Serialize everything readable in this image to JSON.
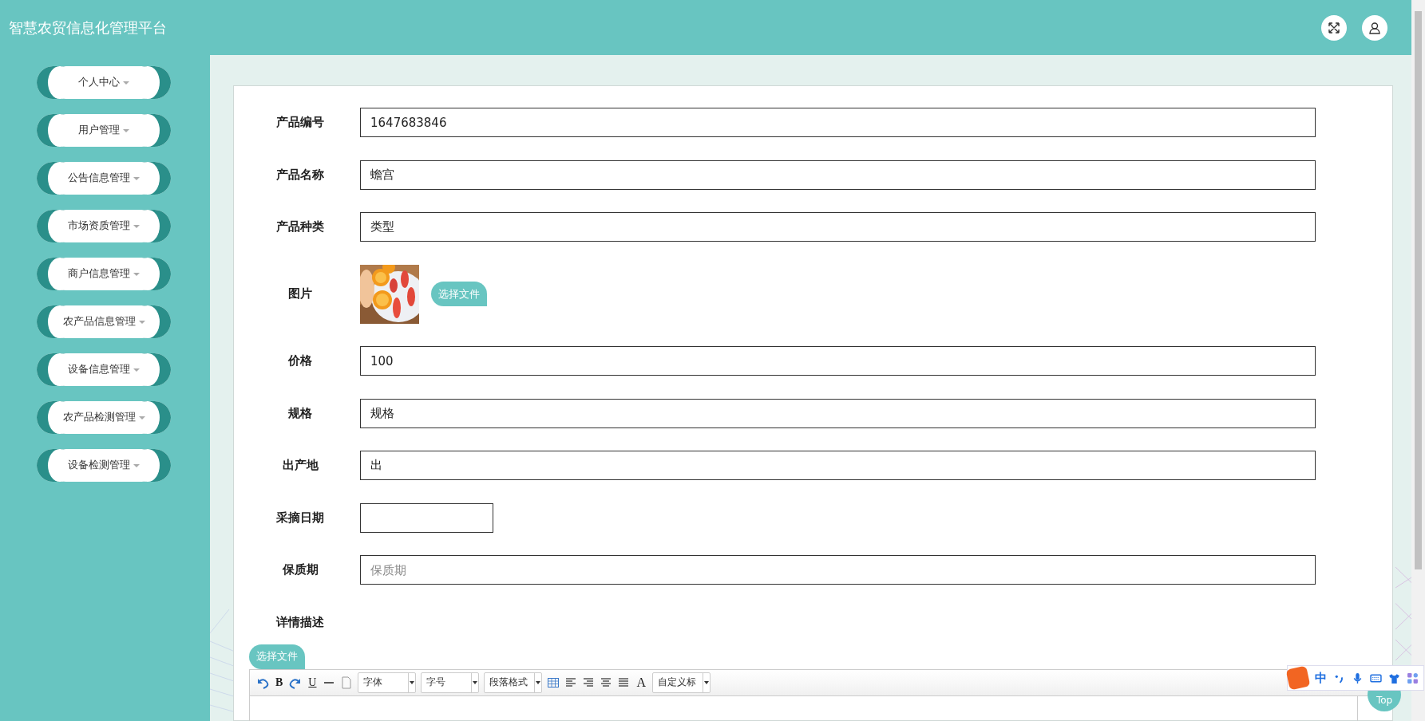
{
  "header": {
    "title": "智慧农贸信息化管理平台"
  },
  "sidebar": {
    "items": [
      {
        "label": "个人中心"
      },
      {
        "label": "用户管理"
      },
      {
        "label": "公告信息管理"
      },
      {
        "label": "市场资质管理"
      },
      {
        "label": "商户信息管理"
      },
      {
        "label": "农产品信息管理"
      },
      {
        "label": "设备信息管理"
      },
      {
        "label": "农产品检测管理"
      },
      {
        "label": "设备检测管理"
      }
    ]
  },
  "form": {
    "fields": [
      {
        "kind": "text",
        "label": "产品编号",
        "value": "1647683846"
      },
      {
        "kind": "text",
        "label": "产品名称",
        "value": "蟾宫"
      },
      {
        "kind": "text",
        "label": "产品种类",
        "value": "类型"
      },
      {
        "label": "图片",
        "button": "选择文件"
      },
      {
        "kind": "text",
        "label": "价格",
        "value": "100"
      },
      {
        "kind": "text",
        "label": "规格",
        "value": "规格"
      },
      {
        "kind": "text",
        "label": "出产地",
        "value": "出"
      },
      {
        "kind": "date",
        "label": "采摘日期"
      },
      {
        "kind": "text",
        "label": "保质期",
        "placeholder": "保质期"
      },
      {
        "kind": "editor",
        "label": "详情描述"
      }
    ],
    "editor": {
      "upload_button": "选择文件",
      "toolbar": [
        {
          "kind": "undo"
        },
        {
          "kind": "glyph",
          "text": "B"
        },
        {
          "kind": "redo"
        },
        {
          "kind": "underline",
          "text": "U"
        },
        {
          "kind": "rule"
        },
        {
          "kind": "page"
        },
        {
          "kind": "select",
          "text": "字体"
        },
        {
          "kind": "select",
          "text": "字号"
        },
        {
          "kind": "select",
          "text": "段落格式"
        },
        {
          "kind": "table"
        },
        {
          "kind": "alignleft"
        },
        {
          "kind": "alignright"
        },
        {
          "kind": "aligncenter"
        },
        {
          "kind": "justify"
        },
        {
          "kind": "color",
          "text": "A"
        },
        {
          "kind": "select",
          "text": "自定义标"
        }
      ]
    }
  },
  "ime_toolbar": {
    "mode": "中"
  },
  "top_button": "Top"
}
